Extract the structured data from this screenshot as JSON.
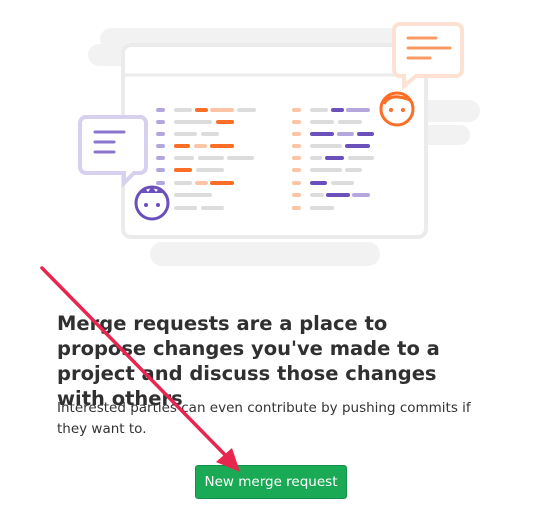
{
  "empty_state": {
    "title": "Merge requests are a place to propose changes you've made to a project and discuss those changes with others",
    "description": "Interested parties can even contribute by pushing commits if they want to.",
    "button_label": "New merge request"
  },
  "colors": {
    "primary_button": "#1aaa55",
    "orange": "#fc6d26",
    "light_orange": "#fdc4a6",
    "purple": "#6b4fbb",
    "light_purple": "#b5a7dd",
    "gray_line": "#dcdcdc",
    "annotation_arrow": "#e8254f"
  },
  "icons": [
    "chat-bubble-icon",
    "avatar-face-icon",
    "arrow-annotation"
  ]
}
